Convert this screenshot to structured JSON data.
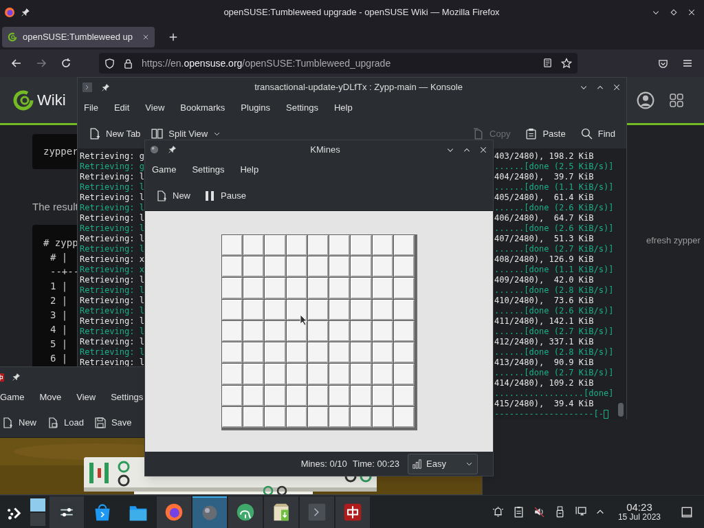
{
  "firefox": {
    "title": "openSUSE:Tumbleweed upgrade - openSUSE Wiki — Mozilla Firefox",
    "tabs": [
      {
        "label": "openSUSE:Tumbleweed up",
        "selected": true
      }
    ],
    "navigation": [
      {
        "kind": "back",
        "disabled": false
      },
      {
        "kind": "forward",
        "disabled": true
      },
      {
        "kind": "reload",
        "disabled": false
      }
    ],
    "url": {
      "scheme": "https://",
      "subdomain": "en.",
      "domain": "opensuse.org",
      "path": "/openSUSE:Tumbleweed_upgrade"
    },
    "page": {
      "site_title": "Wiki",
      "code_block": "zypper",
      "paragraph": "The result",
      "code_lines": [
        "# zypp",
        "# |",
        "--+--",
        "1 |",
        "2 |",
        "3 |",
        "4 |",
        "5 |",
        "6 |"
      ],
      "side_text": "efresh zypper"
    }
  },
  "konsole": {
    "title": "transactional-update-yDLfTx : Zypp-main — Konsole",
    "menu": [
      "File",
      "Edit",
      "View",
      "Bookmarks",
      "Plugins",
      "Settings",
      "Help"
    ],
    "toolbar_left": [
      {
        "kind": "new-tab",
        "label": "New Tab",
        "disabled": false
      },
      {
        "kind": "split",
        "label": "Split View",
        "disabled": false
      }
    ],
    "toolbar_right": [
      {
        "kind": "copy",
        "label": "Copy",
        "disabled": true
      },
      {
        "kind": "paste",
        "label": "Paste",
        "disabled": false
      },
      {
        "kind": "find",
        "label": "Find",
        "disabled": false
      }
    ],
    "left_lines": [
      {
        "text": "Retrieving: g",
        "kind": "plain"
      },
      {
        "text": "Retrieving: g",
        "kind": "green"
      },
      {
        "text": "Retrieving: l",
        "kind": "plain"
      },
      {
        "text": "Retrieving: l",
        "kind": "green"
      },
      {
        "text": "Retrieving: l",
        "kind": "plain"
      },
      {
        "text": "Retrieving: l",
        "kind": "green"
      },
      {
        "text": "Retrieving: l",
        "kind": "plain"
      },
      {
        "text": "Retrieving: l",
        "kind": "green"
      },
      {
        "text": "Retrieving: l",
        "kind": "plain"
      },
      {
        "text": "Retrieving: l",
        "kind": "green"
      },
      {
        "text": "Retrieving: x",
        "kind": "plain"
      },
      {
        "text": "Retrieving: x",
        "kind": "green"
      },
      {
        "text": "Retrieving: l",
        "kind": "plain"
      },
      {
        "text": "Retrieving: l",
        "kind": "green"
      },
      {
        "text": "Retrieving: l",
        "kind": "plain"
      },
      {
        "text": "Retrieving: l",
        "kind": "green"
      },
      {
        "text": "Retrieving: l",
        "kind": "plain"
      },
      {
        "text": "Retrieving: l",
        "kind": "green"
      },
      {
        "text": "Retrieving: l",
        "kind": "plain"
      },
      {
        "text": "Retrieving: l",
        "kind": "green"
      },
      {
        "text": "Retrieving: l",
        "kind": "plain"
      }
    ],
    "right_lines": [
      {
        "text": "403/2480), 198.2 KiB",
        "kind": "plain"
      },
      {
        "text": "......[done (2.5 KiB/s)]",
        "kind": "green"
      },
      {
        "text": "404/2480),  39.7 KiB",
        "kind": "plain"
      },
      {
        "text": "......[done (1.1 KiB/s)]",
        "kind": "green"
      },
      {
        "text": "405/2480),  61.4 KiB",
        "kind": "plain"
      },
      {
        "text": "......[done (2.6 KiB/s)]",
        "kind": "green"
      },
      {
        "text": "406/2480),  64.7 KiB",
        "kind": "plain"
      },
      {
        "text": "......[done (2.6 KiB/s)]",
        "kind": "green"
      },
      {
        "text": "407/2480),  51.3 KiB",
        "kind": "plain"
      },
      {
        "text": "......[done (2.7 KiB/s)]",
        "kind": "green"
      },
      {
        "text": "408/2480), 126.9 KiB",
        "kind": "plain"
      },
      {
        "text": "......[done (1.1 KiB/s)]",
        "kind": "green"
      },
      {
        "text": "409/2480),  42.0 KiB",
        "kind": "plain"
      },
      {
        "text": "......[done (2.8 KiB/s)]",
        "kind": "green"
      },
      {
        "text": "410/2480),  73.6 KiB",
        "kind": "plain"
      },
      {
        "text": "......[done (2.6 KiB/s)]",
        "kind": "green"
      },
      {
        "text": "411/2480), 142.1 KiB",
        "kind": "plain"
      },
      {
        "text": "......[done (2.7 KiB/s)]",
        "kind": "green"
      },
      {
        "text": "412/2480), 337.1 KiB",
        "kind": "plain"
      },
      {
        "text": "......[done (2.8 KiB/s)]",
        "kind": "green"
      },
      {
        "text": "413/2480),  90.9 KiB",
        "kind": "plain"
      },
      {
        "text": "......[done (2.7 KiB/s)]",
        "kind": "green"
      },
      {
        "text": "414/2480), 109.2 KiB",
        "kind": "plain"
      },
      {
        "text": "..................[done]",
        "kind": "green"
      },
      {
        "text": "415/2480),  39.4 KiB",
        "kind": "plain"
      },
      {
        "text": "--------------------[-",
        "kind": "green"
      }
    ]
  },
  "kmines": {
    "title": "KMines",
    "menu": [
      "Game",
      "Settings",
      "Help"
    ],
    "toolbar": [
      {
        "kind": "new",
        "label": "New"
      },
      {
        "kind": "pause",
        "label": "Pause"
      }
    ],
    "mines": "Mines: 0/10",
    "time": "Time: 00:23",
    "difficulty": "Easy"
  },
  "kmahjongg": {
    "menu": [
      "Game",
      "Move",
      "View",
      "Settings"
    ],
    "toolbar": [
      {
        "kind": "new",
        "label": "New"
      },
      {
        "kind": "load",
        "label": "Load"
      },
      {
        "kind": "save",
        "label": "Save"
      }
    ]
  },
  "taskbar": {
    "tasks": [
      {
        "kind": "settings",
        "open": true,
        "selected": false
      },
      {
        "kind": "store",
        "open": false,
        "selected": false
      },
      {
        "kind": "files",
        "open": false,
        "selected": false
      },
      {
        "kind": "firefox",
        "open": true,
        "selected": false
      },
      {
        "kind": "mines",
        "open": true,
        "selected": true
      },
      {
        "kind": "elephant",
        "open": true,
        "selected": false
      },
      {
        "kind": "package",
        "open": true,
        "selected": false
      },
      {
        "kind": "terminal",
        "open": true,
        "selected": false
      },
      {
        "kind": "mahjongg",
        "open": true,
        "selected": false
      }
    ],
    "time": "04:23",
    "date": "15 Jul 2023"
  }
}
